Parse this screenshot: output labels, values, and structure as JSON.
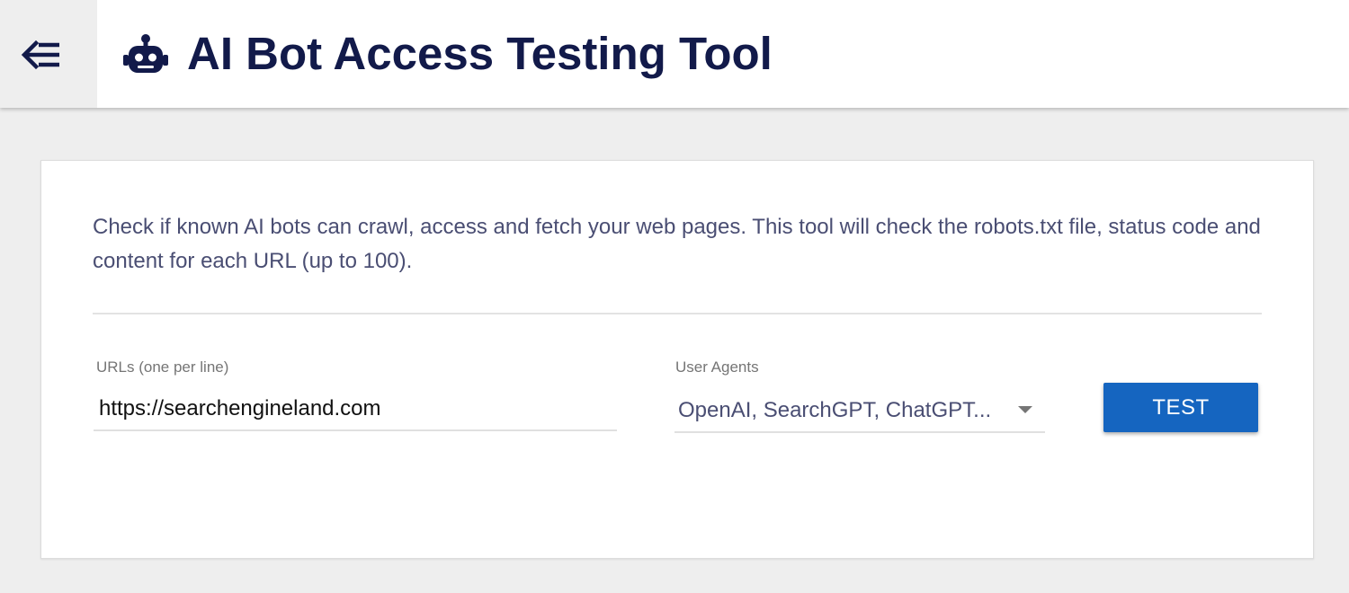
{
  "header": {
    "menu_icon": "menu-collapse-icon",
    "app_icon": "robot-icon",
    "title": "AI Bot Access Testing Tool"
  },
  "main": {
    "description": "Check if known AI bots can crawl, access and fetch your web pages. This tool will check the robots.txt file, status code and content for each URL (up to 100).",
    "urls_field": {
      "label": "URLs (one per line)",
      "value": "https://searchengineland.com"
    },
    "user_agents_field": {
      "label": "User Agents",
      "selected": "OpenAI, SearchGPT, ChatGPT..."
    },
    "test_button": "TEST"
  },
  "colors": {
    "title": "#121a4a",
    "description": "#4a4e73",
    "button": "#1565c0",
    "page_background": "#eeeeee"
  }
}
